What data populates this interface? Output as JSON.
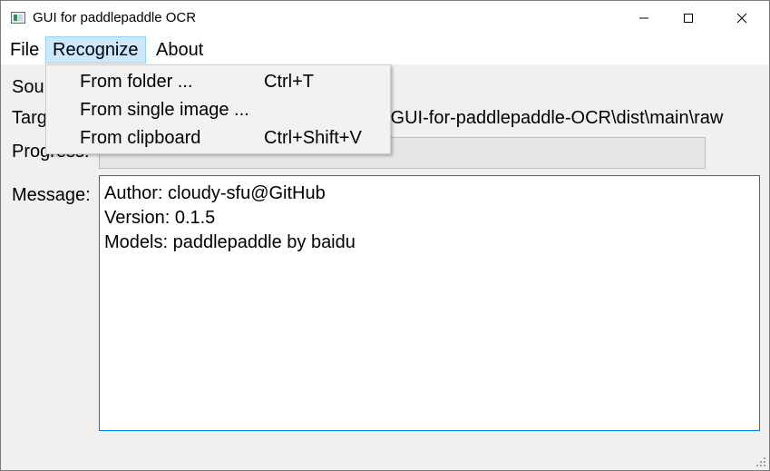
{
  "window": {
    "title": "GUI for paddlepaddle OCR",
    "icons": {
      "app": "app-icon",
      "minimize": "minimize-icon",
      "maximize": "maximize-icon",
      "close": "close-icon"
    }
  },
  "menubar": {
    "items": [
      {
        "label": "File"
      },
      {
        "label": "Recognize"
      },
      {
        "label": "About"
      }
    ]
  },
  "recognize_menu": {
    "items": [
      {
        "label": "From folder ...",
        "shortcut": "Ctrl+T"
      },
      {
        "label": "From single image ...",
        "shortcut": ""
      },
      {
        "label": "From clipboard",
        "shortcut": "Ctrl+Shift+V"
      }
    ]
  },
  "form": {
    "source_label": "Source:",
    "target_label": "Target:",
    "target_value": "\\GUI-for-paddlepaddle-OCR\\dist\\main\\raw",
    "progress_label": "Progress:",
    "progress_value": 0,
    "message_label": "Message:"
  },
  "message": {
    "lines": [
      "Author: cloudy-sfu@GitHub",
      "Version: 0.1.5",
      "Models: paddlepaddle by baidu"
    ]
  },
  "colors": {
    "menu_highlight": "#cce8ff",
    "focus_border": "#0078d7"
  }
}
